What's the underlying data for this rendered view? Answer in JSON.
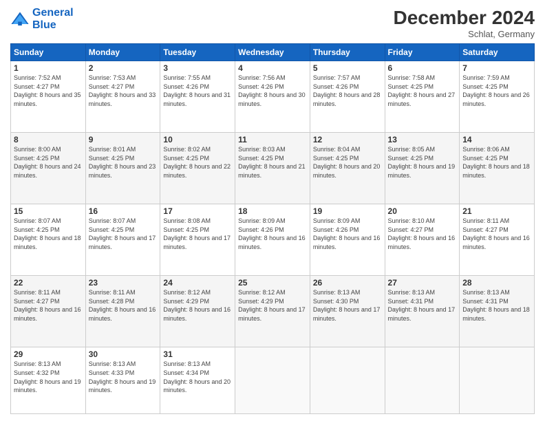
{
  "logo": {
    "line1": "General",
    "line2": "Blue"
  },
  "title": "December 2024",
  "location": "Schlat, Germany",
  "days_header": [
    "Sunday",
    "Monday",
    "Tuesday",
    "Wednesday",
    "Thursday",
    "Friday",
    "Saturday"
  ],
  "weeks": [
    [
      {
        "day": "1",
        "info": "Sunrise: 7:52 AM\nSunset: 4:27 PM\nDaylight: 8 hours\nand 35 minutes."
      },
      {
        "day": "2",
        "info": "Sunrise: 7:53 AM\nSunset: 4:27 PM\nDaylight: 8 hours\nand 33 minutes."
      },
      {
        "day": "3",
        "info": "Sunrise: 7:55 AM\nSunset: 4:26 PM\nDaylight: 8 hours\nand 31 minutes."
      },
      {
        "day": "4",
        "info": "Sunrise: 7:56 AM\nSunset: 4:26 PM\nDaylight: 8 hours\nand 30 minutes."
      },
      {
        "day": "5",
        "info": "Sunrise: 7:57 AM\nSunset: 4:26 PM\nDaylight: 8 hours\nand 28 minutes."
      },
      {
        "day": "6",
        "info": "Sunrise: 7:58 AM\nSunset: 4:25 PM\nDaylight: 8 hours\nand 27 minutes."
      },
      {
        "day": "7",
        "info": "Sunrise: 7:59 AM\nSunset: 4:25 PM\nDaylight: 8 hours\nand 26 minutes."
      }
    ],
    [
      {
        "day": "8",
        "info": "Sunrise: 8:00 AM\nSunset: 4:25 PM\nDaylight: 8 hours\nand 24 minutes."
      },
      {
        "day": "9",
        "info": "Sunrise: 8:01 AM\nSunset: 4:25 PM\nDaylight: 8 hours\nand 23 minutes."
      },
      {
        "day": "10",
        "info": "Sunrise: 8:02 AM\nSunset: 4:25 PM\nDaylight: 8 hours\nand 22 minutes."
      },
      {
        "day": "11",
        "info": "Sunrise: 8:03 AM\nSunset: 4:25 PM\nDaylight: 8 hours\nand 21 minutes."
      },
      {
        "day": "12",
        "info": "Sunrise: 8:04 AM\nSunset: 4:25 PM\nDaylight: 8 hours\nand 20 minutes."
      },
      {
        "day": "13",
        "info": "Sunrise: 8:05 AM\nSunset: 4:25 PM\nDaylight: 8 hours\nand 19 minutes."
      },
      {
        "day": "14",
        "info": "Sunrise: 8:06 AM\nSunset: 4:25 PM\nDaylight: 8 hours\nand 18 minutes."
      }
    ],
    [
      {
        "day": "15",
        "info": "Sunrise: 8:07 AM\nSunset: 4:25 PM\nDaylight: 8 hours\nand 18 minutes."
      },
      {
        "day": "16",
        "info": "Sunrise: 8:07 AM\nSunset: 4:25 PM\nDaylight: 8 hours\nand 17 minutes."
      },
      {
        "day": "17",
        "info": "Sunrise: 8:08 AM\nSunset: 4:25 PM\nDaylight: 8 hours\nand 17 minutes."
      },
      {
        "day": "18",
        "info": "Sunrise: 8:09 AM\nSunset: 4:26 PM\nDaylight: 8 hours\nand 16 minutes."
      },
      {
        "day": "19",
        "info": "Sunrise: 8:09 AM\nSunset: 4:26 PM\nDaylight: 8 hours\nand 16 minutes."
      },
      {
        "day": "20",
        "info": "Sunrise: 8:10 AM\nSunset: 4:27 PM\nDaylight: 8 hours\nand 16 minutes."
      },
      {
        "day": "21",
        "info": "Sunrise: 8:11 AM\nSunset: 4:27 PM\nDaylight: 8 hours\nand 16 minutes."
      }
    ],
    [
      {
        "day": "22",
        "info": "Sunrise: 8:11 AM\nSunset: 4:27 PM\nDaylight: 8 hours\nand 16 minutes."
      },
      {
        "day": "23",
        "info": "Sunrise: 8:11 AM\nSunset: 4:28 PM\nDaylight: 8 hours\nand 16 minutes."
      },
      {
        "day": "24",
        "info": "Sunrise: 8:12 AM\nSunset: 4:29 PM\nDaylight: 8 hours\nand 16 minutes."
      },
      {
        "day": "25",
        "info": "Sunrise: 8:12 AM\nSunset: 4:29 PM\nDaylight: 8 hours\nand 17 minutes."
      },
      {
        "day": "26",
        "info": "Sunrise: 8:13 AM\nSunset: 4:30 PM\nDaylight: 8 hours\nand 17 minutes."
      },
      {
        "day": "27",
        "info": "Sunrise: 8:13 AM\nSunset: 4:31 PM\nDaylight: 8 hours\nand 17 minutes."
      },
      {
        "day": "28",
        "info": "Sunrise: 8:13 AM\nSunset: 4:31 PM\nDaylight: 8 hours\nand 18 minutes."
      }
    ],
    [
      {
        "day": "29",
        "info": "Sunrise: 8:13 AM\nSunset: 4:32 PM\nDaylight: 8 hours\nand 19 minutes."
      },
      {
        "day": "30",
        "info": "Sunrise: 8:13 AM\nSunset: 4:33 PM\nDaylight: 8 hours\nand 19 minutes."
      },
      {
        "day": "31",
        "info": "Sunrise: 8:13 AM\nSunset: 4:34 PM\nDaylight: 8 hours\nand 20 minutes."
      },
      null,
      null,
      null,
      null
    ]
  ]
}
